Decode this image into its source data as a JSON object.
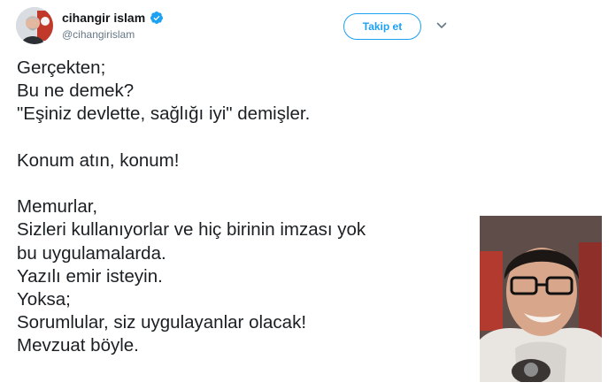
{
  "user": {
    "display_name": "cihangir islam",
    "handle": "@cihangirislam",
    "verified": true
  },
  "actions": {
    "follow_label": "Takip et"
  },
  "tweet": {
    "lines": [
      "Gerçekten;",
      "Bu ne demek?",
      "\"Eşiniz devlette, sağlığı iyi\" demişler.",
      "",
      "Konum atın, konum!",
      "",
      "Memurlar,",
      "Sizleri kullanıyorlar ve hiç birinin imzası yok",
      "bu uygulamalarda.",
      "Yazılı emir isteyin.",
      "Yoksa;",
      "Sorumlular, siz uygulayanlar olacak!",
      "Mevzuat böyle."
    ]
  },
  "icons": {
    "verified": "verified-badge-icon",
    "menu": "chevron-down-icon"
  },
  "colors": {
    "accent": "#1da1f2",
    "text": "#14171a",
    "muted": "#657786"
  }
}
